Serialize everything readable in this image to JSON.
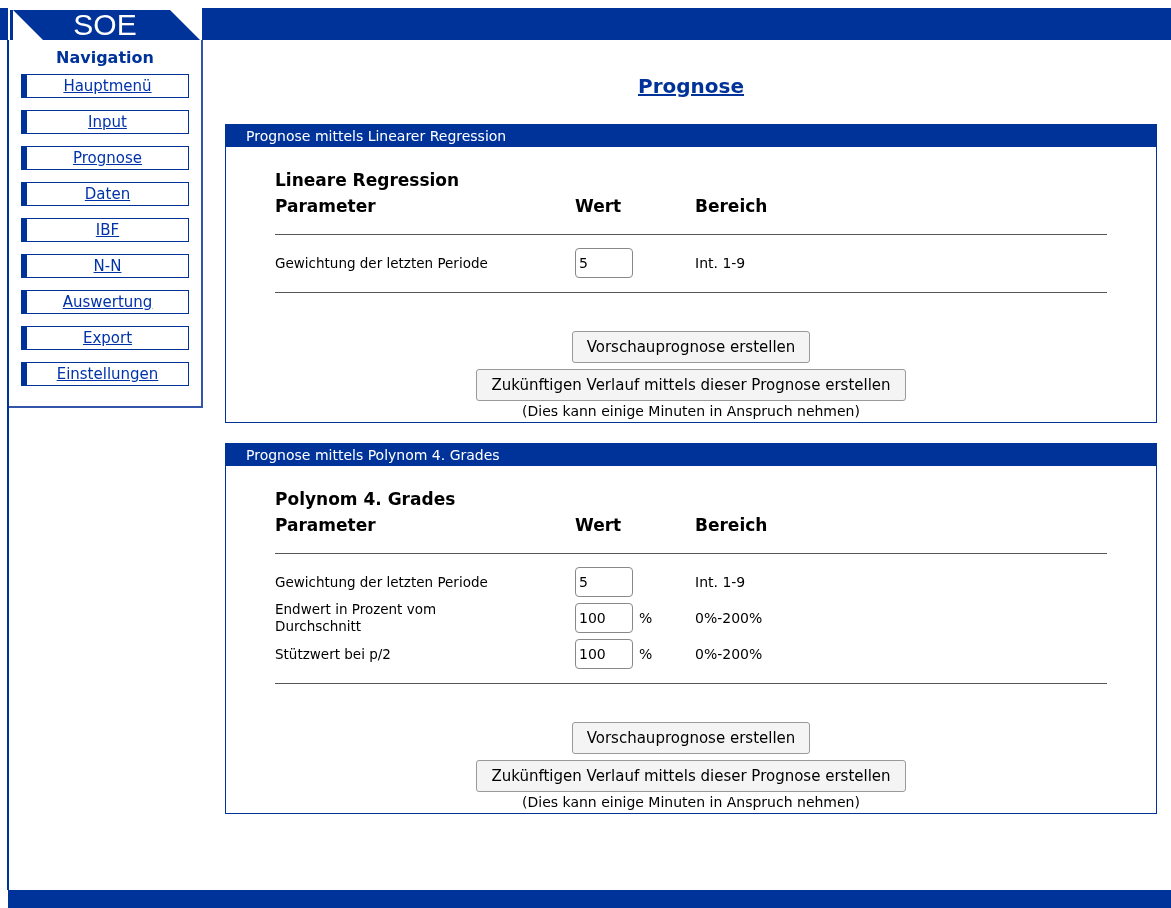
{
  "logo": "SOE",
  "navigation": {
    "title": "Navigation",
    "items": [
      "Hauptmenü",
      "Input",
      "Prognose",
      "Daten",
      "IBF",
      "N-N",
      "Auswertung",
      "Export",
      "Einstellungen"
    ]
  },
  "page_title": "Prognose",
  "panels": [
    {
      "header": "Prognose mittels Linearer Regression",
      "title": "Lineare Regression",
      "columns": [
        "Parameter",
        "Wert",
        "Bereich"
      ],
      "rows": [
        {
          "label": "Gewichtung der letzten Periode",
          "value": "5",
          "range": "Int. 1-9"
        }
      ],
      "buttons": [
        "Vorschauprognose erstellen",
        "Zukünftigen Verlauf mittels dieser Prognose erstellen"
      ],
      "note": "(Dies kann einige Minuten in Anspruch nehmen)"
    },
    {
      "header": "Prognose mittels Polynom 4. Grades",
      "title": "Polynom 4. Grades",
      "columns": [
        "Parameter",
        "Wert",
        "Bereich"
      ],
      "rows": [
        {
          "label": "Gewichtung der letzten Periode",
          "value": "5",
          "range": "Int. 1-9"
        },
        {
          "label": "Endwert in Prozent vom Durchschnitt",
          "value": "100",
          "unit": "%",
          "range": "0%-200%"
        },
        {
          "label": "Stützwert bei p/2",
          "value": "100",
          "unit": "%",
          "range": "0%-200%"
        }
      ],
      "buttons": [
        "Vorschauprognose erstellen",
        "Zukünftigen Verlauf mittels dieser Prognose erstellen"
      ],
      "note": "(Dies kann einige Minuten in Anspruch nehmen)"
    }
  ]
}
